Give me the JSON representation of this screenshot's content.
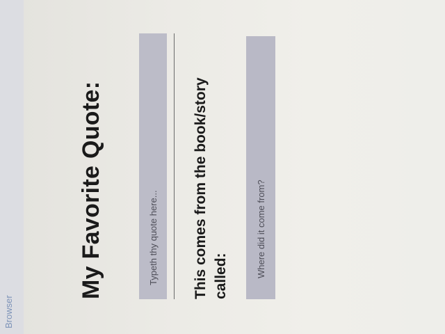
{
  "browser": {
    "label": "Browser"
  },
  "form": {
    "heading": "My Favorite Quote:",
    "quote_placeholder": "Typeth thy quote here...",
    "source_label": "This comes from the book/story called:",
    "source_placeholder": "Where did it come from?"
  }
}
